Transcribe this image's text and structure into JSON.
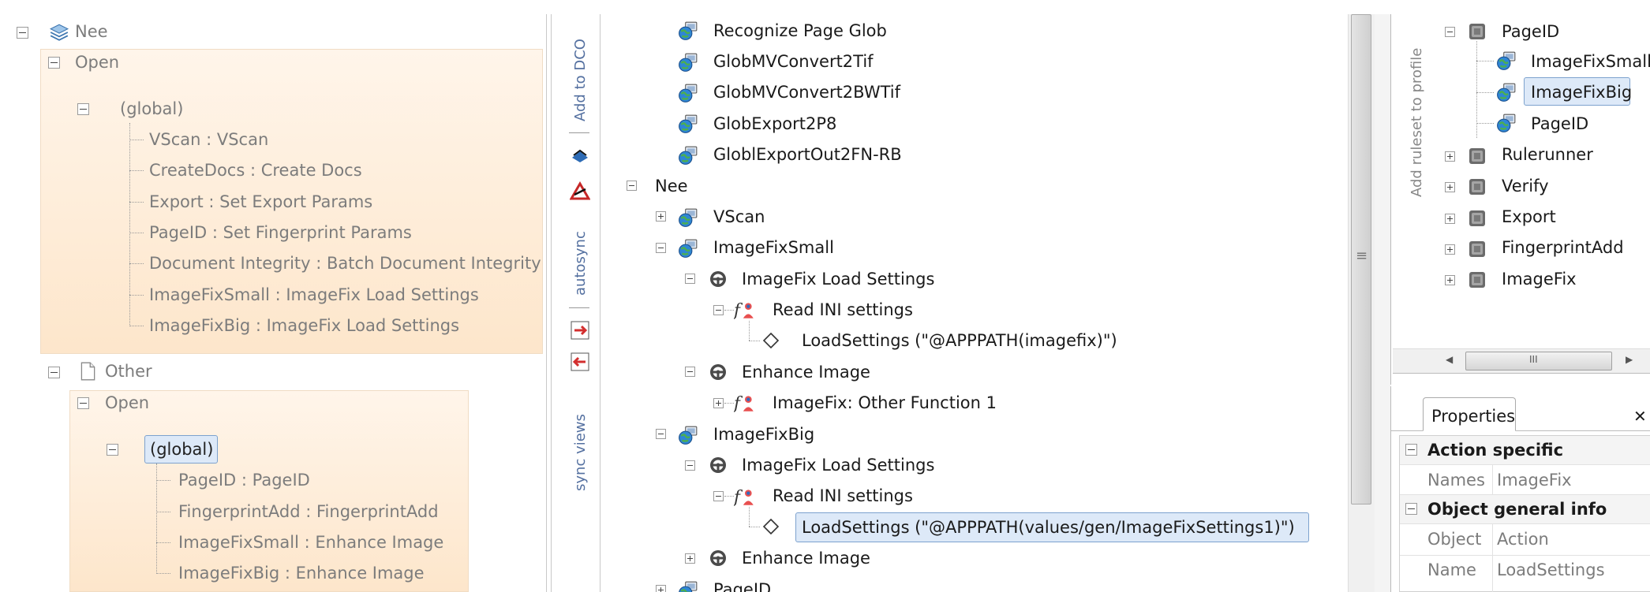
{
  "left_tree": {
    "nee": {
      "label": "Nee"
    },
    "open1": {
      "label": "Open"
    },
    "global1": {
      "label": "(global)"
    },
    "items1": [
      {
        "label": "VScan : VScan"
      },
      {
        "label": "CreateDocs : Create Docs"
      },
      {
        "label": "Export : Set Export Params"
      },
      {
        "label": "PageID : Set Fingerprint Params"
      },
      {
        "label": "Document Integrity : Batch Document Integrity"
      },
      {
        "label": "ImageFixSmall : ImageFix Load Settings"
      },
      {
        "label": "ImageFixBig : ImageFix Load Settings"
      }
    ],
    "other": {
      "label": "Other"
    },
    "open2": {
      "label": "Open"
    },
    "global2": {
      "label": "(global)"
    },
    "items2": [
      {
        "label": "PageID : PageID"
      },
      {
        "label": "FingerprintAdd : FingerprintAdd"
      },
      {
        "label": "ImageFixSmall : Enhance Image"
      },
      {
        "label": "ImageFixBig : Enhance Image"
      }
    ]
  },
  "toolbar_left": {
    "add_to_dco": "Add to DCO",
    "autosync": "autosync",
    "sync_views": "sync views"
  },
  "center_tree": {
    "top_items": [
      {
        "label": "Recognize Page Glob"
      },
      {
        "label": "GlobMVConvert2Tif"
      },
      {
        "label": "GlobMVConvert2BWTif"
      },
      {
        "label": "GlobExport2P8"
      },
      {
        "label": "GloblExportOut2FN-RB"
      }
    ],
    "nee": "Nee",
    "vscan": "VScan",
    "imagefix_small": {
      "label": "ImageFixSmall",
      "load_settings": "ImageFix Load Settings",
      "read_ini": "Read INI settings",
      "load_call": "LoadSettings (\"@APPPATH(imagefix)\")",
      "enhance": "Enhance Image",
      "other_func": "ImageFix: Other Function 1"
    },
    "imagefix_big": {
      "label": "ImageFixBig",
      "load_settings": "ImageFix Load Settings",
      "read_ini": "Read INI settings",
      "load_call": "LoadSettings (\"@APPPATH(values/gen/ImageFixSettings1)\")",
      "enhance": "Enhance Image"
    },
    "pageid_partial": "PageID"
  },
  "splitter": {
    "grip": "≡"
  },
  "right_tree": {
    "side_label": "Add ruleset to profile",
    "pageid": "PageID",
    "children": [
      {
        "label": "ImageFixSmall"
      },
      {
        "label": "ImageFixBig"
      },
      {
        "label": "PageID"
      }
    ],
    "siblings": [
      {
        "label": "Rulerunner"
      },
      {
        "label": "Verify"
      },
      {
        "label": "Export"
      },
      {
        "label": "FingerprintAdd"
      },
      {
        "label": "ImageFix"
      }
    ],
    "hscroll_grip": "III"
  },
  "properties": {
    "tab": "Properties",
    "close": "✕",
    "section1": "Action specific",
    "rows1": [
      {
        "key": "Names",
        "value": "ImageFix"
      }
    ],
    "section2": "Object general info",
    "rows2": [
      {
        "key": "Object",
        "value": "Action"
      },
      {
        "key": "Name",
        "value": "LoadSettings"
      }
    ]
  }
}
